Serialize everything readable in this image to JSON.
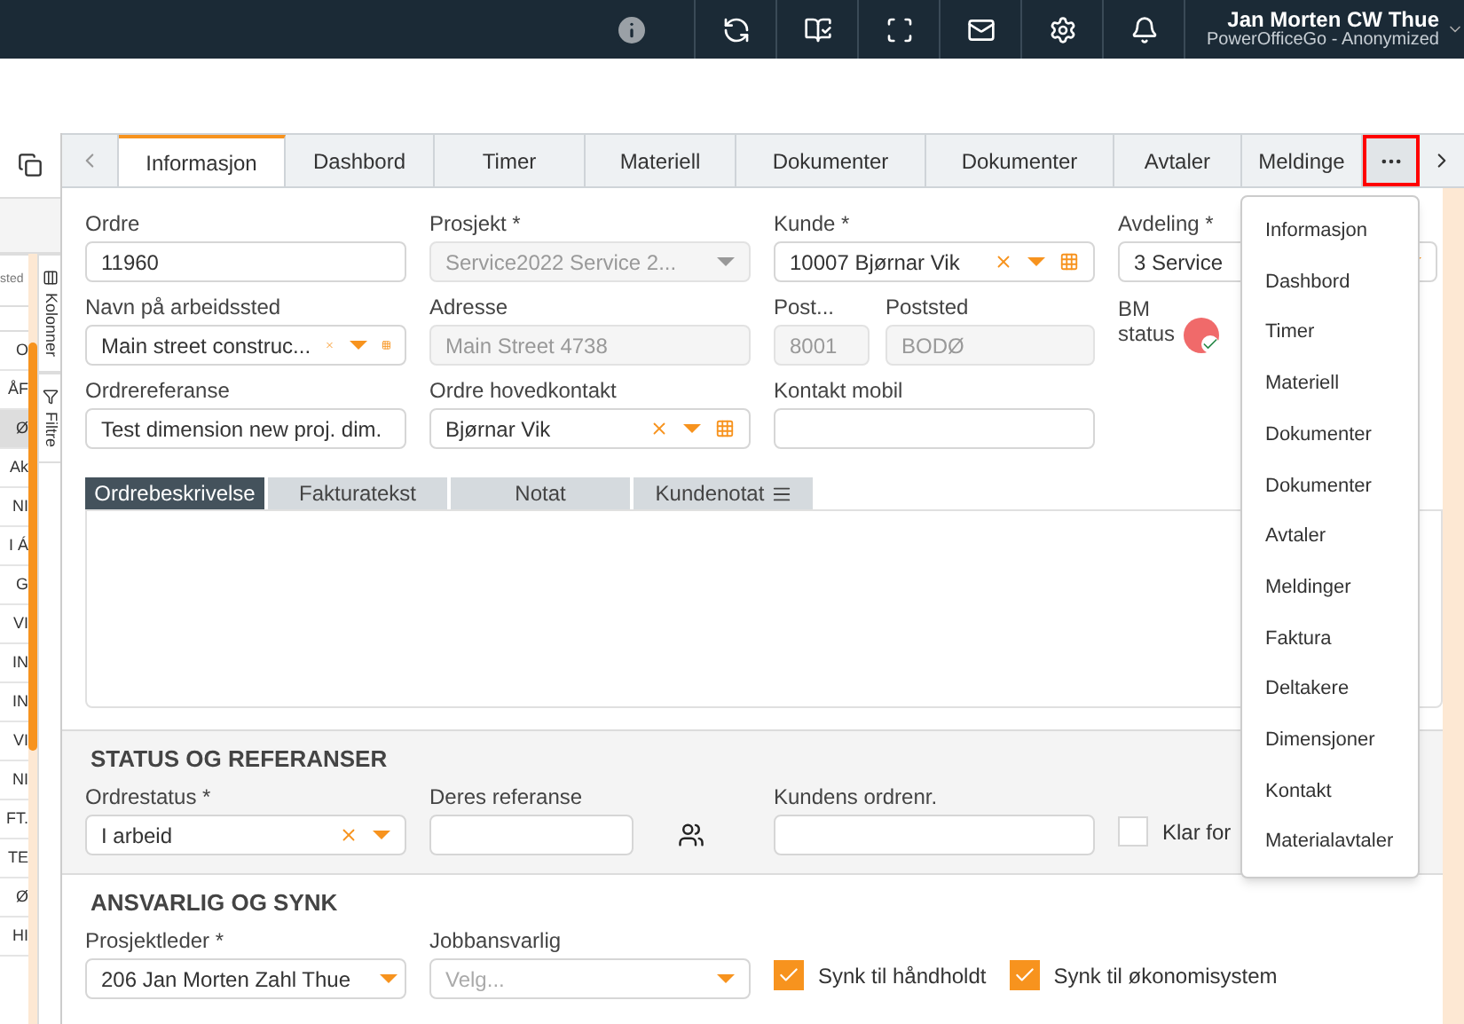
{
  "topbar": {
    "user_name": "Jan Morten CW Thue",
    "user_org": "PowerOfficeGo - Anonymized"
  },
  "left_panel": {
    "header": "sted",
    "cells": [
      "O",
      "ÅF",
      "Ø",
      "Ak",
      "NI",
      "I Á",
      "G",
      "VI",
      "IN",
      "IN",
      "VI",
      "NI",
      "FT.",
      "TE",
      "Ø",
      "HI"
    ],
    "side_tabs": [
      "Kolonner",
      "Filtre"
    ]
  },
  "tabs": [
    {
      "label": "Informasjon",
      "selected": true
    },
    {
      "label": "Dashbord",
      "selected": false
    },
    {
      "label": "Timer",
      "selected": false
    },
    {
      "label": "Materiell",
      "selected": false
    },
    {
      "label": "Dokumenter",
      "selected": false
    },
    {
      "label": "Dokumenter",
      "selected": false
    },
    {
      "label": "Avtaler",
      "selected": false
    },
    {
      "label": "Meldinge",
      "selected": false
    }
  ],
  "tab_menu": {
    "open": true,
    "items": [
      "Informasjon",
      "Dashbord",
      "Timer",
      "Materiell",
      "Dokumenter",
      "Dokumenter",
      "Avtaler",
      "Meldinger",
      "Faktura",
      "Deltakere",
      "Dimensjoner",
      "Kontakt",
      "Materialavtaler"
    ]
  },
  "form_rows": [
    [
      {
        "kind": "text",
        "label": "Ordre",
        "value": "11960",
        "disabled": false
      },
      {
        "kind": "select",
        "label": "Prosjekt *",
        "value": "Service2022 Service 2...",
        "disabled": true
      },
      {
        "kind": "lookup",
        "label": "Kunde *",
        "value": "10007 Bjørnar Vik",
        "disabled": false
      },
      {
        "kind": "select",
        "label": "Avdeling *",
        "value": "3 Service",
        "disabled": false
      }
    ],
    [
      {
        "kind": "lookup",
        "label": "Navn på arbeidssted",
        "value": "Main street construc...",
        "disabled": false
      },
      {
        "kind": "text",
        "label": "Adresse",
        "value": "Main Street 4738",
        "disabled": true
      },
      {
        "kind": "small",
        "label": "Post...",
        "value": "8001",
        "disabled": true
      },
      {
        "kind": "medium",
        "label": "Poststed",
        "value": "BODØ",
        "disabled": true
      },
      {
        "kind": "status",
        "label": "BM status"
      }
    ],
    [
      {
        "kind": "text",
        "label": "Ordrereferanse",
        "value": "Test dimension new proj. dim.",
        "disabled": false
      },
      {
        "kind": "lookup",
        "label": "Ordre hovedkontakt",
        "value": "Bjørnar Vik",
        "disabled": false
      },
      {
        "kind": "text",
        "label": "Kontakt mobil",
        "disabled": false
      }
    ]
  ],
  "text_tabs": [
    {
      "label": "Ordrebeskrivelse",
      "selected": true,
      "kind": "plain"
    },
    {
      "label": "Fakturatekst",
      "selected": false,
      "kind": "plain"
    },
    {
      "label": "Notat",
      "selected": false,
      "kind": "plain"
    },
    {
      "label": "Kundenotat",
      "selected": false,
      "kind": "note"
    }
  ],
  "status_section": {
    "title": "STATUS OG REFERANSER",
    "fields": [
      {
        "kind": "combo",
        "label": "Ordrestatus *",
        "value": "I arbeid"
      },
      {
        "kind": "people",
        "label": "Deres referanse"
      },
      {
        "kind": "text",
        "label": "Kundens ordrenr."
      },
      {
        "kind": "checkbox",
        "label": "Klar for",
        "checked": false
      }
    ]
  },
  "responsible_section": {
    "title": "ANSVARLIG OG SYNK",
    "fields": [
      {
        "kind": "combo",
        "label": "Prosjektleder *",
        "value": "206 Jan Morten Zahl Thue"
      },
      {
        "kind": "select",
        "label": "Jobbansvarlig",
        "placeholder": "Velg..."
      },
      {
        "kind": "checkbox",
        "label": "Synk til håndholdt",
        "checked": true
      },
      {
        "kind": "checkbox",
        "label": "Synk til økonomisystem",
        "checked": true
      }
    ]
  }
}
